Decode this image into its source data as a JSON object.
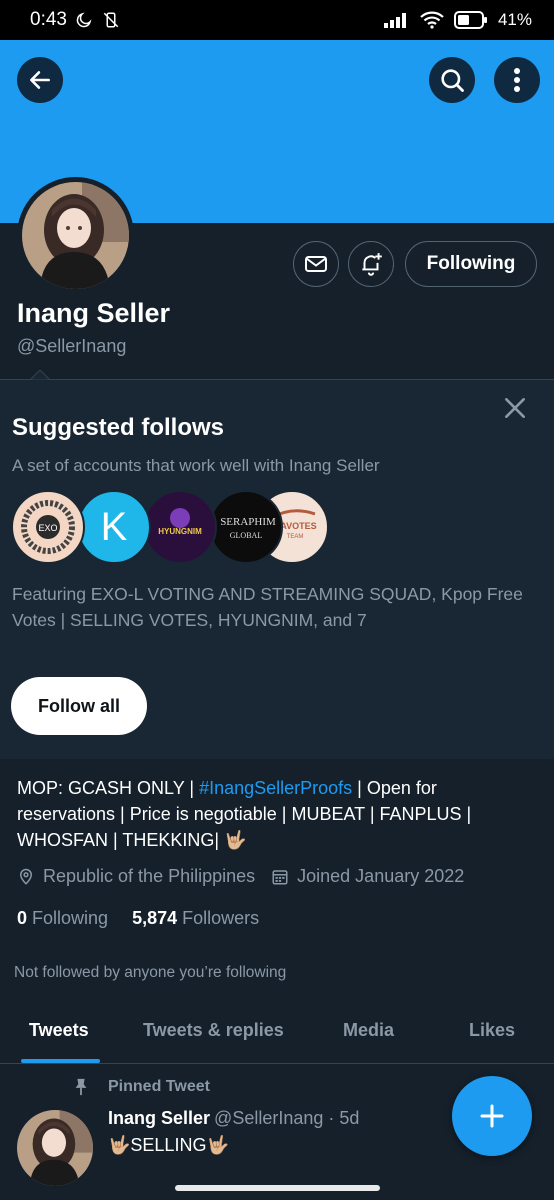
{
  "status_bar": {
    "time": "0:43",
    "battery": "41%"
  },
  "profile": {
    "name": "Inang Seller",
    "handle": "@SellerInang",
    "following_button": "Following"
  },
  "suggested": {
    "title": "Suggested follows",
    "subtitle": "A set of accounts that work well with Inang Seller",
    "avatars": [
      {
        "name": "exol-squad-avatar",
        "text": "EXO-L VOTING SQUAD",
        "bg": "#f3d7c4"
      },
      {
        "name": "kpop-free-votes-avatar",
        "text": "K",
        "bg": "#1fb6ea"
      },
      {
        "name": "hyungnim-avatar",
        "text": "HYUNGNIM",
        "bg": "#2a0f3c"
      },
      {
        "name": "seraphim-global-avatar",
        "text": "SERAPHIM GLOBAL",
        "bg": "#0c0c0c"
      },
      {
        "name": "gavotes-team-avatar",
        "text": "GAVOTES TEAM",
        "bg": "#f4e2d6"
      }
    ],
    "featuring": "Featuring EXO-L VOTING AND STREAMING SQUAD, Kpop Free Votes | SELLING VOTES, HYUNGNIM, and 7",
    "follow_all": "Follow all"
  },
  "bio": {
    "part1": "MOP: GCASH ONLY | ",
    "link": "#InangSellerProofs",
    "part2": " | Open for reservations | Price is negotiable | MUBEAT | FANPLUS | WHOSFAN | THEKKING| 🤟🏼"
  },
  "meta": {
    "location": "Republic of the Philippines",
    "joined": "Joined January 2022"
  },
  "counts": {
    "following_num": "0",
    "following_label": "Following",
    "followers_num": "5,874",
    "followers_label": "Followers"
  },
  "not_followed": "Not followed by anyone you’re following",
  "tabs": [
    "Tweets",
    "Tweets & replies",
    "Media",
    "Likes"
  ],
  "pinned_tweet": {
    "label": "Pinned Tweet",
    "name": "Inang Seller",
    "meta": "@SellerInang · 5d",
    "text": "🤟🏼SELLING🤟🏼"
  },
  "colors": {
    "accent": "#1d9bf0",
    "background": "#15202b",
    "panel": "#192734",
    "muted": "#8b98a5"
  },
  "icons": [
    "back-arrow-icon",
    "search-icon",
    "more-vertical-icon",
    "mail-icon",
    "bell-plus-icon",
    "close-icon",
    "location-icon",
    "calendar-icon",
    "pin-icon",
    "plus-icon"
  ]
}
